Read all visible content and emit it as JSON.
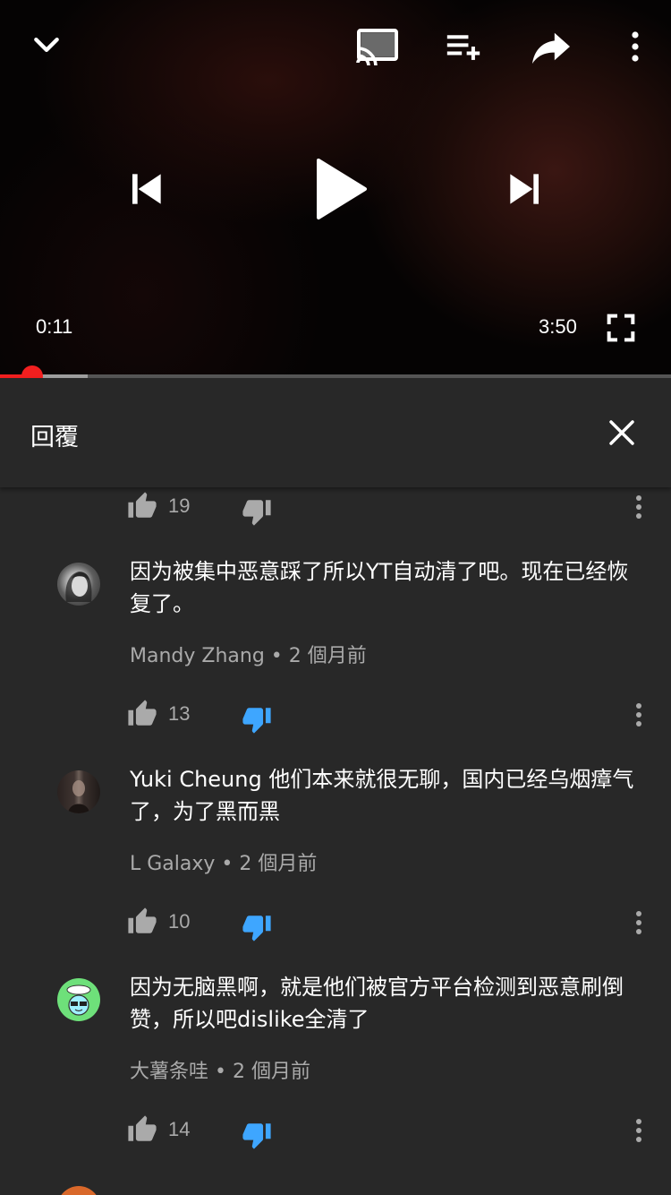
{
  "player": {
    "current_time": "0:11",
    "duration": "3:50",
    "progress_fraction": 0.048,
    "buffer_fraction": 0.13,
    "icons": {
      "collapse": "chevron-down-icon",
      "cast": "cast-icon",
      "add_to_playlist": "playlist-add-icon",
      "share": "share-icon",
      "more": "more-vert-icon",
      "previous": "skip-previous-icon",
      "play": "play-icon",
      "next": "skip-next-icon",
      "fullscreen": "fullscreen-icon"
    }
  },
  "panel": {
    "title": "回覆",
    "close_icon": "close-icon"
  },
  "colors": {
    "accent_red": "#f21f1f",
    "liked_blue": "#3ea6ff",
    "panel_bg": "#282828",
    "secondary_text": "#aaaaaa"
  },
  "first_actions": {
    "likes": "19"
  },
  "comments": [
    {
      "author": "Mandy Zhang",
      "time": "2 個月前",
      "text": "因为被集中恶意踩了所以YT自动清了吧。现在已经恢复了。",
      "likes": "13"
    },
    {
      "author": "L Galaxy",
      "time": "2 個月前",
      "text": "Yuki Cheung 他们本来就很无聊，国内已经乌烟瘴气了，为了黑而黑",
      "likes": "10"
    },
    {
      "author": "大薯条哇",
      "time": "2 個月前",
      "text": "因为无脑黑啊，就是他们被官方平台检测到恶意刷倒赞，所以吧dislike全清了",
      "likes": "14"
    },
    {
      "author": "",
      "time": "",
      "text": "",
      "likes": ""
    }
  ]
}
